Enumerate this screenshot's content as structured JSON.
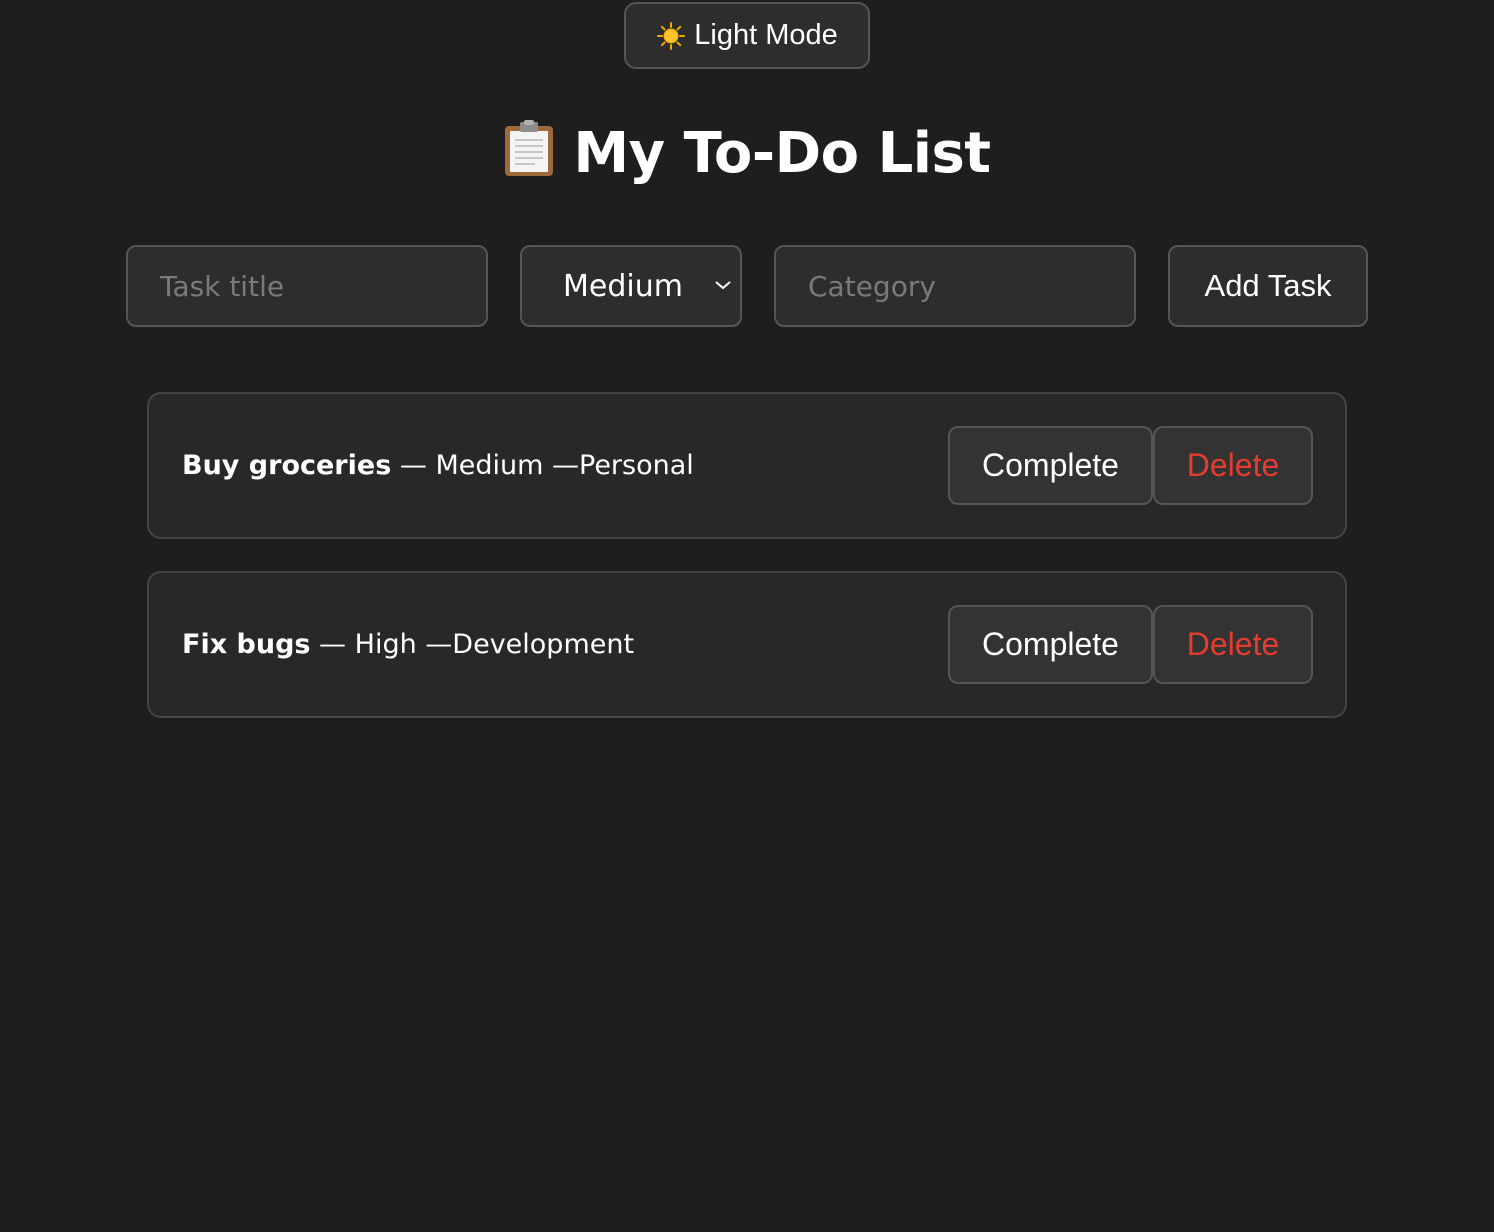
{
  "theme_toggle": {
    "label": "Light Mode",
    "icon": "sun-icon"
  },
  "header": {
    "title": "My To-Do List",
    "icon": "clipboard-icon"
  },
  "form": {
    "title_placeholder": "Task title",
    "priority_selected": "Medium",
    "category_placeholder": "Category",
    "add_label": "Add Task"
  },
  "tasks": [
    {
      "title": "Buy groceries",
      "priority": "Medium",
      "category": "Personal",
      "complete_label": "Complete",
      "delete_label": "Delete"
    },
    {
      "title": "Fix bugs",
      "priority": "High",
      "category": "Development",
      "complete_label": "Complete",
      "delete_label": "Delete"
    }
  ],
  "colors": {
    "background": "#1e1e1e",
    "delete": "#e53c2f"
  }
}
